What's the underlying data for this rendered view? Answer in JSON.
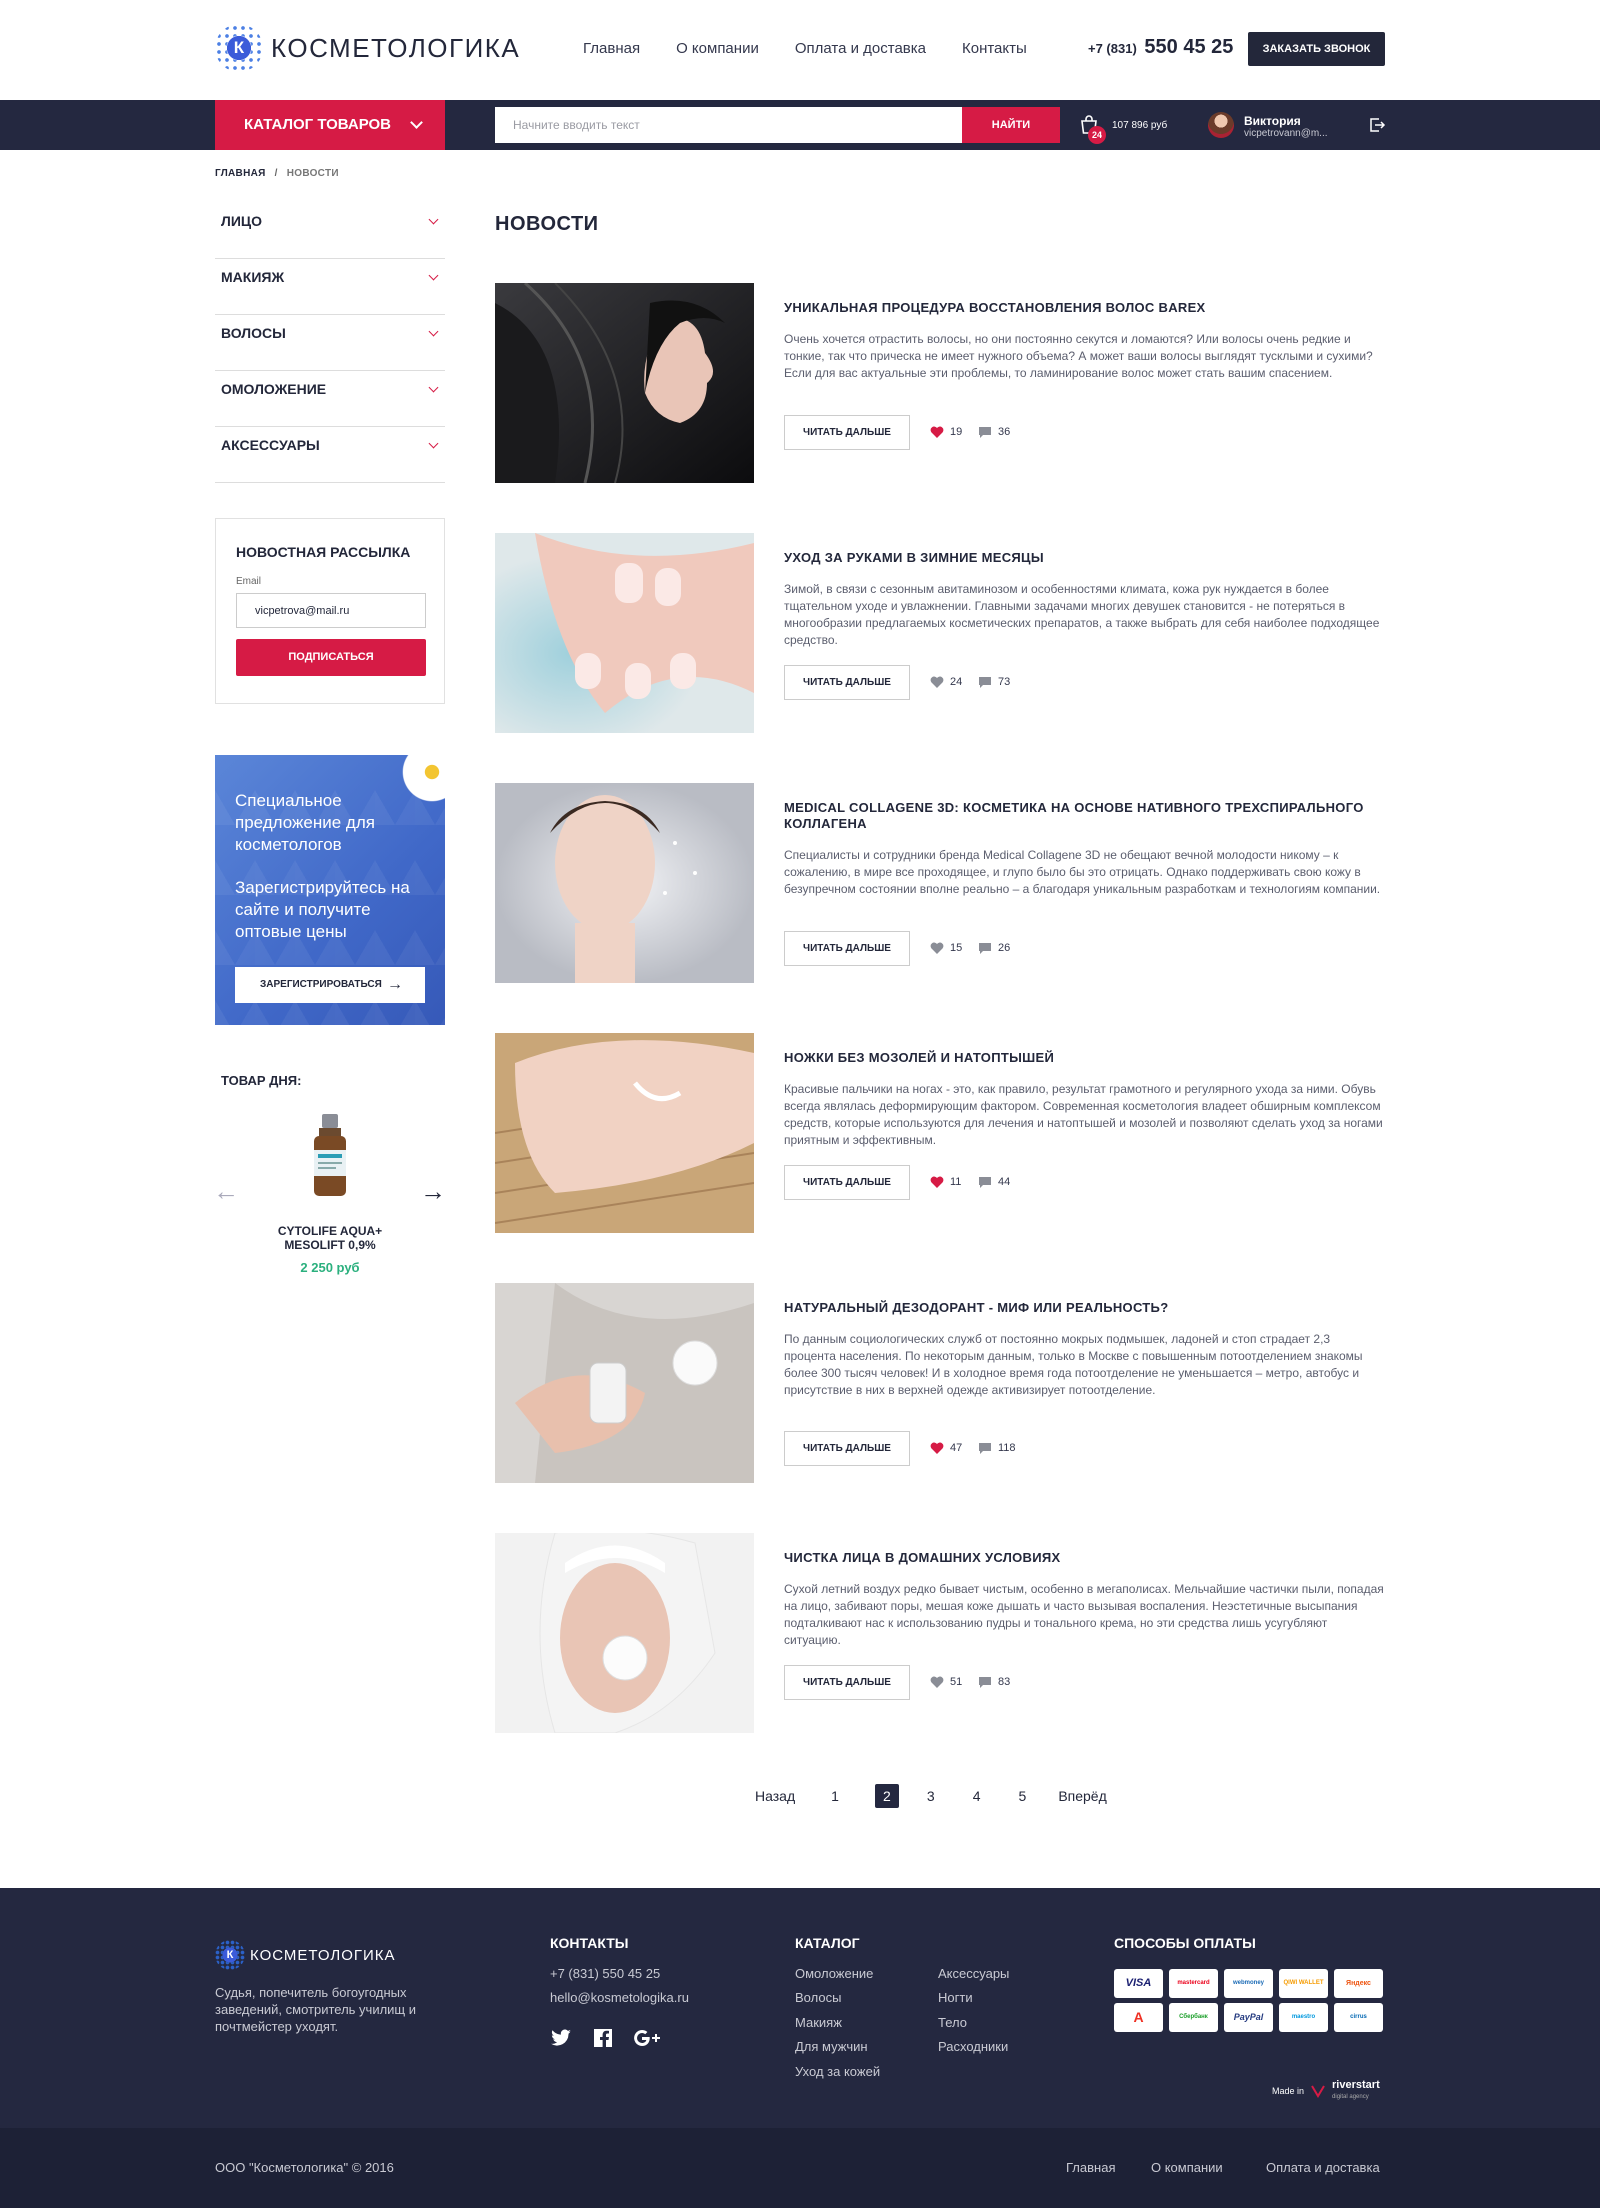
{
  "brand": {
    "logo_letter": "К",
    "name": "КОСМЕТОЛОГИКА"
  },
  "topnav": [
    "Главная",
    "О компании",
    "Оплата и доставка",
    "Контакты"
  ],
  "phone": {
    "code": "+7 (831)",
    "number": "550 45 25"
  },
  "call_button": "ЗАКАЗАТЬ ЗВОНОК",
  "catalog_button": "КАТАЛОГ ТОВАРОВ",
  "search": {
    "placeholder": "Начните вводить текст",
    "button": "НАЙТИ"
  },
  "cart": {
    "count": "24",
    "sum": "107 896 руб"
  },
  "user": {
    "name": "Виктория",
    "email": "vicpetrovann@m..."
  },
  "breadcrumbs": {
    "home": "ГЛАВНАЯ",
    "separator": "/",
    "current": "НОВОСТИ"
  },
  "side_menu": [
    "ЛИЦО",
    "МАКИЯЖ",
    "ВОЛОСЫ",
    "ОМОЛОЖЕНИЕ",
    "АКСЕССУАРЫ"
  ],
  "newsletter": {
    "title": "НОВОСТНАЯ РАССЫЛКА",
    "label": "Email",
    "value": "vicpetrova@mail.ru",
    "button": "ПОДПИСАТЬСЯ"
  },
  "promo": {
    "line1": "Специальное предложение для косметологов",
    "line2": "Зарегистрируйтесь на сайте и получите оптовые цены",
    "button": "ЗАРЕГИСТРИРОВАТЬСЯ"
  },
  "product_of_day": {
    "title": "ТОВАР ДНЯ:",
    "name": "CYTOLIFE AQUA+ MESOLIFT 0,9%",
    "price": "2 250 руб"
  },
  "page_title": "НОВОСТИ",
  "read_more": "ЧИТАТЬ ДАЛЬШЕ",
  "news": [
    {
      "title": "УНИКАЛЬНАЯ ПРОЦЕДУРА ВОССТАНОВЛЕНИЯ ВОЛОС BAREX",
      "text": "Очень хочется отрастить волосы, но они постоянно секутся и ломаются? Или волосы очень редкие и тонкие, так что прическа не имеет нужного объема? А может ваши волосы выглядят тусклыми и сухими? Если для вас актуальные эти проблемы, то ламинирование волос может стать вашим спасением.",
      "likes": "19",
      "comments": "36",
      "liked": true,
      "image": "hair-woman-photo"
    },
    {
      "title": "УХОД ЗА РУКАМИ В ЗИМНИЕ МЕСЯЦЫ",
      "text": "Зимой, в связи с сезонным авитаминозом и особенностями климата, кожа рук нуждается в более тщательном уходе и увлажнении. Главными задачами многих девушек становится - не потеряться в многообразии предлагаемых косметических препаратов, а также выбрать для себя наиболее подходящее средство.",
      "likes": "24",
      "comments": "73",
      "liked": false,
      "image": "hands-salt-photo"
    },
    {
      "title": "MEDICAL COLLAGENE 3D: КОСМЕТИКА НА ОСНОВЕ НАТИВНОГО ТРЕХСПИРАЛЬНОГО КОЛЛАГЕНА",
      "text": "Специалисты и сотрудники бренда Medical Collagene 3D не обещают вечной молодости никому – к сожалению, в мире все проходящее, и глупо было бы это отрицать. Однако поддерживать свою кожу в безупречном состоянии вполне реально – а благодаря уникальным разработкам и технологиям компании.",
      "likes": "15",
      "comments": "26",
      "liked": false,
      "image": "face-woman-photo"
    },
    {
      "title": "НОЖКИ БЕЗ МОЗОЛЕЙ И НАТОПТЫШЕЙ",
      "text": "Красивые пальчики на ногах - это, как правило, результат грамотного и регулярного ухода за ними. Обувь всегда являлась деформирующим фактором. Современная косметология владеет обширным комплексом средств, которые используются для лечения и натоптышей и мозолей и позволяют сделать уход за ногами приятным и эффективным.",
      "likes": "11",
      "comments": "44",
      "liked": true,
      "image": "feet-photo"
    },
    {
      "title": "НАТУРАЛЬНЫЙ ДЕЗОДОРАНТ - МИФ ИЛИ РЕАЛЬНОСТЬ?",
      "text": "По данным социологических служб от постоянно мокрых подмышек, ладоней и стоп страдает 2,3 процента населения. По некоторым данным, только в Москве с повышенным потоотделением знакомы более 300 тысяч человек! И в холодное время года потоотделение не уменьшается – метро, автобус и присутствие в них в верхней одежде активизирует потоотделение.",
      "likes": "47",
      "comments": "118",
      "liked": true,
      "image": "deodorant-photo"
    },
    {
      "title": "ЧИСТКА ЛИЦА В ДОМАШНИХ УСЛОВИЯХ",
      "text": "Сухой летний воздух редко бывает чистым, особенно в мегаполисах. Мельчайшие частички пыли, попадая на лицо, забивают поры, мешая коже дышать и часто вызывая воспаления. Неэстетичные высыпания подталкивают нас к использованию пудры и тонального крема, но эти средства лишь усугубляют ситуацию.",
      "likes": "51",
      "comments": "83",
      "liked": false,
      "image": "face-cleaning-photo"
    }
  ],
  "pagination": {
    "prev": "Назад",
    "pages": [
      "1",
      "2",
      "3",
      "4",
      "5"
    ],
    "current": "2",
    "next": "Вперёд"
  },
  "footer": {
    "about": "Судья, попечитель богоугодных заведений, смотритель училищ и почтмейстер уходят.",
    "contacts_title": "КОНТАКТЫ",
    "phone": "+7 (831) 550 45 25",
    "email": "hello@kosmetologika.ru",
    "catalog_title": "КАТАЛОГ",
    "catalog_col1": [
      "Омоложение",
      "Волосы",
      "Макияж",
      "Для мужчин",
      "Уход за кожей"
    ],
    "catalog_col2": [
      "Аксессуары",
      "Ногти",
      "Тело",
      "Расходники"
    ],
    "payment_title": "СПОСОБЫ ОПЛАТЫ",
    "payments": [
      "VISA",
      "mastercard",
      "webmoney",
      "QIWI WALLET",
      "Яндекс",
      "А",
      "Сбербанк",
      "PayPal",
      "maestro",
      "cirrus"
    ],
    "made_in": "Made in",
    "made_by": "riverstart",
    "made_by_sub": "digital agency",
    "copyright": "ООО \"Косметологика\" © 2016",
    "bottom_nav": [
      "Главная",
      "О компании",
      "Оплата и доставка"
    ]
  },
  "colors": {
    "accent": "#d61b45",
    "dark": "#242840",
    "price": "#2bb07e"
  }
}
